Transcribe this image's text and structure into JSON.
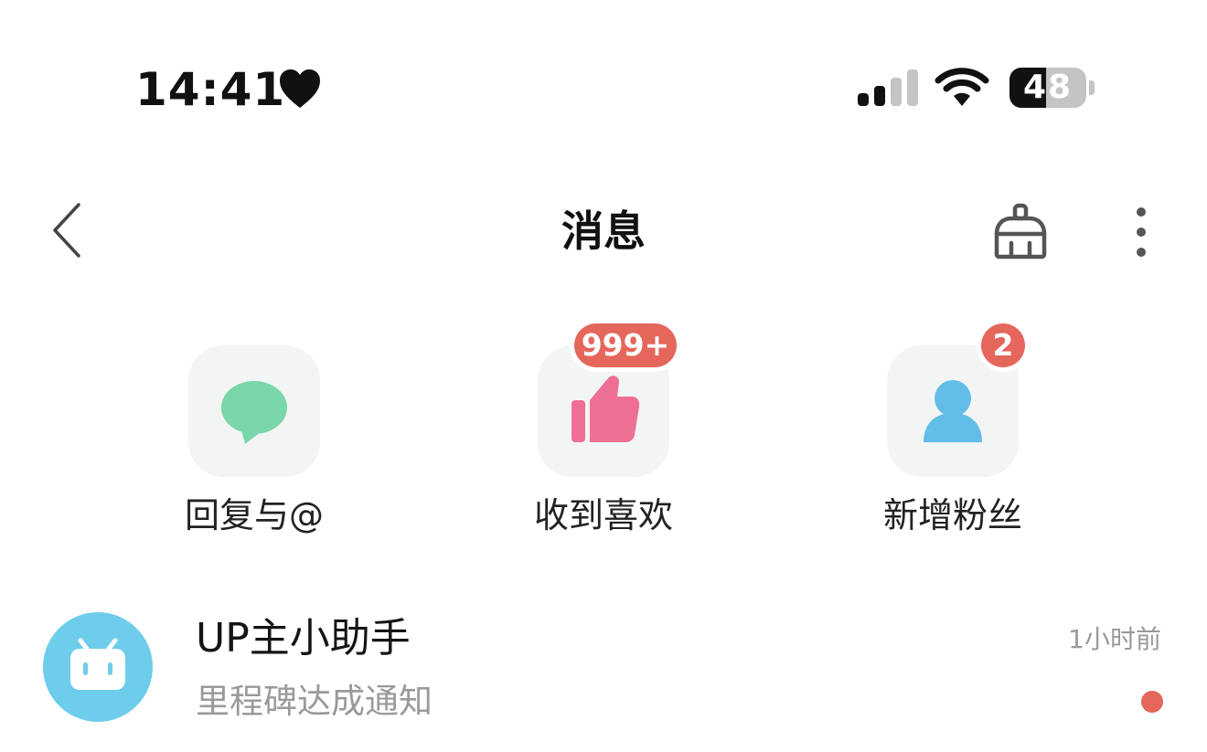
{
  "status_bar": {
    "time": "14:41",
    "battery_level": "48",
    "battery_fraction": 0.48,
    "icons": [
      "heart-icon",
      "cellular-signal-icon",
      "wifi-icon",
      "battery-icon"
    ]
  },
  "header": {
    "title": "消息",
    "back_icon": "chevron-left-icon",
    "clean_icon": "broom-icon",
    "more_icon": "vertical-ellipsis-icon"
  },
  "categories": [
    {
      "label": "回复与@",
      "icon": "speech-bubble-icon",
      "icon_color": "#78d6a8",
      "badge": ""
    },
    {
      "label": "收到喜欢",
      "icon": "thumbs-up-icon",
      "icon_color": "#ee6f94",
      "badge": "999+"
    },
    {
      "label": "新增粉丝",
      "icon": "person-icon",
      "icon_color": "#63bde9",
      "badge": "2"
    }
  ],
  "messages": [
    {
      "title": "UP主小助手",
      "preview": "里程碑达成通知",
      "time": "1小时前",
      "avatar_icon": "tv-robot-icon",
      "avatar_color": "#6dcdeb",
      "unread": true
    }
  ],
  "colors": {
    "badge_red": "#e5665b",
    "tile_background": "#f3f5f5",
    "secondary_text": "#9a9a9a"
  }
}
